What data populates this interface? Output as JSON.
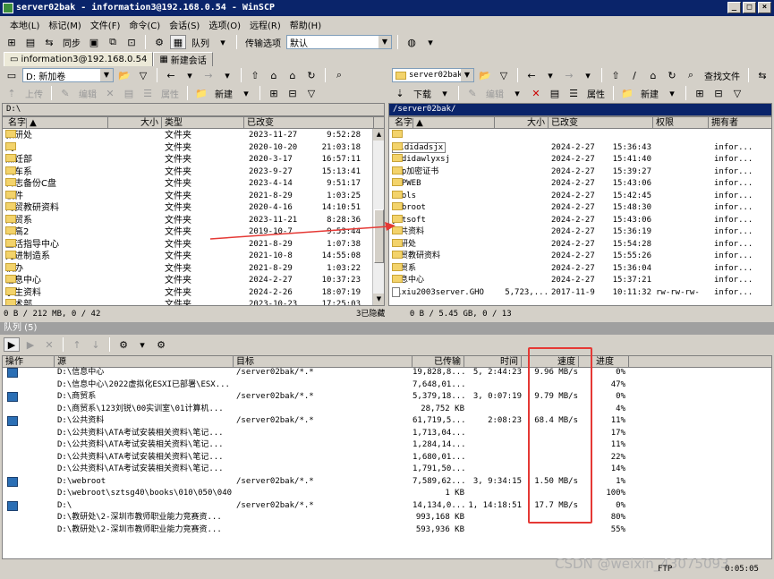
{
  "window": {
    "title": "server02bak - information3@192.168.0.54 - WinSCP",
    "buttons": [
      "_",
      "□",
      "×"
    ]
  },
  "menu": [
    "本地(L)",
    "标记(M)",
    "文件(F)",
    "命令(C)",
    "会话(S)",
    "选项(O)",
    "远程(R)",
    "帮助(H)"
  ],
  "toolbar": {
    "sync_label": "同步",
    "queue_label": "队列",
    "transfer_options_label": "传输选项",
    "transfer_preset": "默认"
  },
  "tabs": [
    {
      "label": "information3@192.168.0.54"
    },
    {
      "label": "新建会话"
    }
  ],
  "local": {
    "drive": "D: 新加卷",
    "upload_label": "上传",
    "edit_label": "编辑",
    "props_label": "属性",
    "new_label": "新建",
    "path": "D:\\",
    "columns": [
      "名字",
      "大小",
      "类型",
      "已改变"
    ],
    "files": [
      {
        "name": "教研处",
        "type": "文件夹",
        "date": "2023-11-27",
        "time": "9:52:28"
      },
      {
        "name": "刘",
        "type": "文件夹",
        "date": "2020-10-20",
        "time": "21:03:18"
      },
      {
        "name": "烹饪部",
        "type": "文件夹",
        "date": "2020-3-17",
        "time": "16:57:11"
      },
      {
        "name": "汽车系",
        "type": "文件夹",
        "date": "2023-9-27",
        "time": "15:13:41"
      },
      {
        "name": "日志备份C盘",
        "type": "文件夹",
        "date": "2023-4-14",
        "time": "9:51:17"
      },
      {
        "name": "软件",
        "type": "文件夹",
        "date": "2021-8-29",
        "time": "1:03:25"
      },
      {
        "name": "商贸教研资料",
        "type": "文件夹",
        "date": "2020-4-16",
        "time": "14:10:51"
      },
      {
        "name": "商贸系",
        "type": "文件夹",
        "date": "2023-11-21",
        "time": "8:28:36"
      },
      {
        "name": "申高2",
        "type": "文件夹",
        "date": "2019-10-7",
        "time": "9:53:44"
      },
      {
        "name": "生活指导中心",
        "type": "文件夹",
        "date": "2021-8-29",
        "time": "1:07:38"
      },
      {
        "name": "先进制造系",
        "type": "文件夹",
        "date": "2021-10-8",
        "time": "14:55:08"
      },
      {
        "name": "校办",
        "type": "文件夹",
        "date": "2021-8-29",
        "time": "1:03:22"
      },
      {
        "name": "信息中心",
        "type": "文件夹",
        "date": "2024-2-27",
        "time": "10:37:23"
      },
      {
        "name": "学生资料",
        "type": "文件夹",
        "date": "2024-2-26",
        "time": "18:07:19"
      },
      {
        "name": "艺术部",
        "type": "文件夹",
        "date": "2023-10-23",
        "time": "17:25:03"
      }
    ],
    "status": "0 B / 212 MB,  0 / 42"
  },
  "remote": {
    "folder": "server02bak",
    "find_label": "查找文件",
    "download_label": "下载",
    "edit_label": "编辑",
    "props_label": "属性",
    "new_label": "新建",
    "path": "/server02bak/",
    "columns": [
      "名字",
      "大小",
      "已改变",
      "权限",
      "拥有者"
    ],
    "files": [
      {
        "name": "..",
        "size": "",
        "date": "",
        "time": "",
        "perm": "",
        "owner": "",
        "kind": "parent"
      },
      {
        "name": "dididadsjx",
        "size": "",
        "date": "2024-2-27",
        "time": "15:36:43",
        "perm": "",
        "owner": "infor...",
        "kind": "folder",
        "boxed": true
      },
      {
        "name": "dididawlyxsj",
        "size": "",
        "date": "2024-2-27",
        "time": "15:41:40",
        "perm": "",
        "owner": "infor...",
        "kind": "folder"
      },
      {
        "name": "ftp加密证书",
        "size": "",
        "date": "2024-2-27",
        "time": "15:39:27",
        "perm": "",
        "owner": "infor...",
        "kind": "folder"
      },
      {
        "name": "PMPWEB",
        "size": "",
        "date": "2024-2-27",
        "time": "15:43:06",
        "perm": "",
        "owner": "infor...",
        "kind": "folder"
      },
      {
        "name": "tools",
        "size": "",
        "date": "2024-2-27",
        "time": "15:42:45",
        "perm": "",
        "owner": "infor...",
        "kind": "folder"
      },
      {
        "name": "webroot",
        "size": "",
        "date": "2024-2-27",
        "time": "15:48:30",
        "perm": "",
        "owner": "infor...",
        "kind": "folder"
      },
      {
        "name": "yntsoft",
        "size": "",
        "date": "2024-2-27",
        "time": "15:43:06",
        "perm": "",
        "owner": "infor...",
        "kind": "folder"
      },
      {
        "name": "公共资料",
        "size": "",
        "date": "2024-2-27",
        "time": "15:36:19",
        "perm": "",
        "owner": "infor...",
        "kind": "folder"
      },
      {
        "name": "教研处",
        "size": "",
        "date": "2024-2-27",
        "time": "15:54:28",
        "perm": "",
        "owner": "infor...",
        "kind": "folder"
      },
      {
        "name": "商贸教研资料",
        "size": "",
        "date": "2024-2-27",
        "time": "15:55:26",
        "perm": "",
        "owner": "infor...",
        "kind": "folder"
      },
      {
        "name": "商贸系",
        "size": "",
        "date": "2024-2-27",
        "time": "15:36:04",
        "perm": "",
        "owner": "infor...",
        "kind": "folder"
      },
      {
        "name": "信息中心",
        "size": "",
        "date": "2024-2-27",
        "time": "15:37:21",
        "perm": "",
        "owner": "infor...",
        "kind": "folder"
      },
      {
        "name": "qixiu2003server.GHO",
        "size": "5,723,...",
        "date": "2017-11-9",
        "time": "10:11:32",
        "perm": "rw-rw-rw-",
        "owner": "infor...",
        "kind": "file"
      }
    ],
    "status": "0 B / 5.45 GB,  0 / 13",
    "hidden": "3已隐藏"
  },
  "queue": {
    "title": "队列 (5)",
    "columns": [
      "操作",
      "源",
      "目标",
      "已传输",
      "时间",
      "速度",
      "进度"
    ],
    "rows": [
      {
        "icon": true,
        "source": "D:\\信息中心",
        "target": "/server02bak/*.*",
        "transferred": "19,828,8...",
        "time": "5, 2:44:23",
        "speed": "9.96 MB/s",
        "progress": "0%"
      },
      {
        "icon": false,
        "source": "D:\\信息中心\\2022虚拟化ESXI已部署\\ESX...",
        "target": "",
        "transferred": "7,648,01...",
        "time": "",
        "speed": "",
        "progress": "47%"
      },
      {
        "icon": true,
        "source": "D:\\商贸系",
        "target": "/server02bak/*.*",
        "transferred": "5,379,18...",
        "time": "3, 0:07:19",
        "speed": "9.79 MB/s",
        "progress": "0%"
      },
      {
        "icon": false,
        "source": "D:\\商贸系\\123刘锐\\00实训室\\01计算机...",
        "target": "",
        "transferred": "28,752 KB",
        "time": "",
        "speed": "",
        "progress": "4%"
      },
      {
        "icon": true,
        "source": "D:\\公共资料",
        "target": "/server02bak/*.*",
        "transferred": "61,719,5...",
        "time": "2:08:23",
        "speed": "68.4 MB/s",
        "progress": "11%"
      },
      {
        "icon": false,
        "source": "D:\\公共资料\\ATA考试安装相关资料\\笔记...",
        "target": "",
        "transferred": "1,713,04...",
        "time": "",
        "speed": "",
        "progress": "17%"
      },
      {
        "icon": false,
        "source": "D:\\公共资料\\ATA考试安装相关资料\\笔记...",
        "target": "",
        "transferred": "1,284,14...",
        "time": "",
        "speed": "",
        "progress": "11%"
      },
      {
        "icon": false,
        "source": "D:\\公共资料\\ATA考试安装相关资料\\笔记...",
        "target": "",
        "transferred": "1,680,01...",
        "time": "",
        "speed": "",
        "progress": "22%"
      },
      {
        "icon": false,
        "source": "D:\\公共资料\\ATA考试安装相关资料\\笔记...",
        "target": "",
        "transferred": "1,791,50...",
        "time": "",
        "speed": "",
        "progress": "14%"
      },
      {
        "icon": true,
        "source": "D:\\webroot",
        "target": "/server02bak/*.*",
        "transferred": "7,589,62...",
        "time": "3, 9:34:15",
        "speed": "1.50 MB/s",
        "progress": "1%"
      },
      {
        "icon": false,
        "source": "D:\\webroot\\sztsg40\\books\\010\\050\\040...",
        "target": "",
        "transferred": "1 KB",
        "time": "",
        "speed": "",
        "progress": "100%"
      },
      {
        "icon": true,
        "source": "D:\\",
        "target": "/server02bak/*.*",
        "transferred": "14,134,0...",
        "time": "1, 14:18:51",
        "speed": "17.7 MB/s",
        "progress": "0%"
      },
      {
        "icon": false,
        "source": "D:\\教研处\\2-深圳市教师职业能力竞赛资...",
        "target": "",
        "transferred": "993,168 KB",
        "time": "",
        "speed": "",
        "progress": "80%"
      },
      {
        "icon": false,
        "source": "D:\\教研处\\2-深圳市教师职业能力竞赛资...",
        "target": "",
        "transferred": "593,936 KB",
        "time": "",
        "speed": "",
        "progress": "55%"
      }
    ]
  },
  "statusbar": {
    "right": "0:05:05",
    "ftp": "FTP",
    "watermark": "CSDN @weixin_43075093"
  },
  "colors": {
    "title_bg": "#0a246a",
    "highlight": "#e53935",
    "arrow": "#e53935"
  }
}
